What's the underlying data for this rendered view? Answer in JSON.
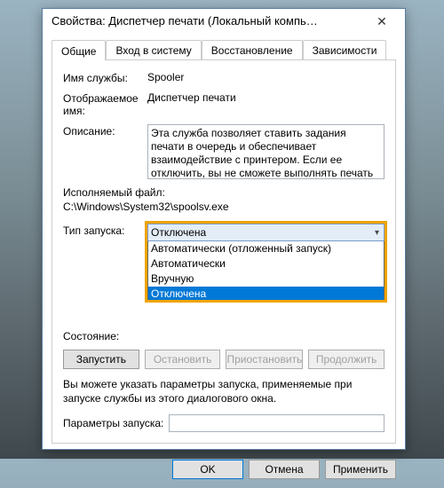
{
  "window": {
    "title": "Свойства: Диспетчер печати (Локальный компь…"
  },
  "tabs": [
    {
      "label": "Общие"
    },
    {
      "label": "Вход в систему"
    },
    {
      "label": "Восстановление"
    },
    {
      "label": "Зависимости"
    }
  ],
  "fields": {
    "service_name_label": "Имя службы:",
    "service_name_value": "Spooler",
    "display_name_label": "Отображаемое имя:",
    "display_name_value": "Диспетчер печати",
    "description_label": "Описание:",
    "description_value": "Эта служба позволяет ставить задания печати в очередь и обеспечивает взаимодействие с принтером. Если ее отключить, вы не сможете выполнять печать и видеть свои принтеры.",
    "exe_label": "Исполняемый файл:",
    "exe_value": "C:\\Windows\\System32\\spoolsv.exe",
    "startup_label": "Тип запуска:",
    "startup_selected": "Отключена",
    "startup_options": [
      "Автоматически (отложенный запуск)",
      "Автоматически",
      "Вручную",
      "Отключена"
    ],
    "state_label": "Состояние:",
    "state_value": "",
    "hint_text": "Вы можете указать параметры запуска, применяемые при запуске службы из этого диалогового окна.",
    "params_label": "Параметры запуска:",
    "params_value": ""
  },
  "service_buttons": {
    "start": "Запустить",
    "stop": "Остановить",
    "pause": "Приостановить",
    "resume": "Продолжить"
  },
  "dialog_buttons": {
    "ok": "OK",
    "cancel": "Отмена",
    "apply": "Применить"
  }
}
